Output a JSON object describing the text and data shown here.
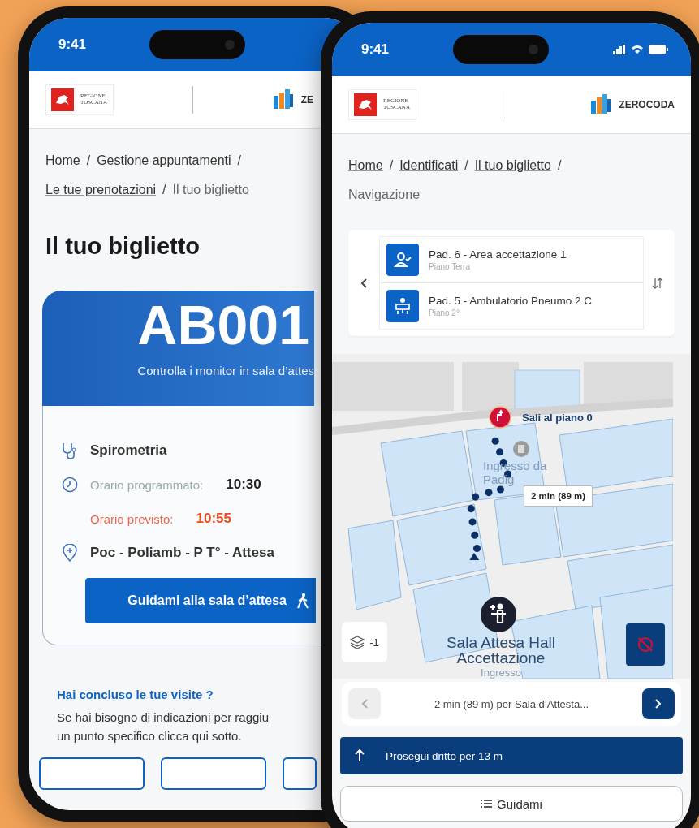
{
  "phones": [
    {
      "kind": "ticket",
      "status_bar": {
        "time": "9:41"
      },
      "header": {
        "region_logo": "REGIONE TOSCANA",
        "brand_logo": "ZE"
      },
      "breadcrumbs": [
        {
          "label": "Home",
          "current": false,
          "separator": "/"
        },
        {
          "label": "Gestione appuntamenti",
          "current": false,
          "separator": "/"
        },
        {
          "label": "Le tue prenotazioni",
          "current": false,
          "separator": "/"
        },
        {
          "label": "Il tuo biglietto",
          "current": true
        }
      ],
      "title": "Il tuo biglietto",
      "ticket": {
        "code": "AB001",
        "note": "Controlla i monitor in sala d’attes"
      },
      "details": [
        {
          "kind": "service",
          "label": "Spirometria"
        },
        {
          "kind": "scheduled",
          "label": "Orario programmato:",
          "value": "10:30"
        },
        {
          "kind": "expected",
          "label": "Orario previsto:",
          "value": "10:55"
        },
        {
          "kind": "location",
          "label": "Poc - Poliamb - P T° - Attesa"
        }
      ],
      "guide_button": "Guidami alla sala d’attesa",
      "question": "Hai concluso le tue visite ?",
      "help_lines": [
        "Se hai bisogno di indicazioni per raggiu",
        "un punto specifico clicca qui sotto."
      ]
    },
    {
      "kind": "navigation",
      "status_bar": {
        "time": "9:41"
      },
      "header": {
        "region_logo": "REGIONE TOSCANA",
        "brand_logo": "ZEROCODA"
      },
      "breadcrumbs": [
        {
          "label": "Home",
          "current": false,
          "separator": "/"
        },
        {
          "label": "Identificati",
          "current": false,
          "separator": "/"
        },
        {
          "label": "Il tuo biglietto",
          "current": false,
          "separator": "/"
        },
        {
          "label": "Navigazione",
          "current": true
        }
      ],
      "route": [
        {
          "kind": "from",
          "name": "Pad. 6 - Area accettazione 1",
          "floor": "Piano Terra"
        },
        {
          "kind": "to",
          "name": "Pad. 5 - Ambulatorio Pneumo 2 C",
          "floor": "Piano 2°"
        }
      ],
      "map": {
        "step_label": "Sali al piano 0",
        "eta": "2 min (89 m)",
        "floor": "-1",
        "labels": [
          "Ingresso da",
          "Padig"
        ],
        "destination": [
          "Sala Attesa Hall",
          "Accettazione"
        ],
        "entrance": "Ingresso"
      },
      "route_bar": {
        "text": "2 min (89 m) per Sala d’Attesta...",
        "prev_disabled": true,
        "next_disabled": false
      },
      "instruction": "Prosegui dritto per 13 m",
      "guide_button": "Guidami"
    }
  ]
}
